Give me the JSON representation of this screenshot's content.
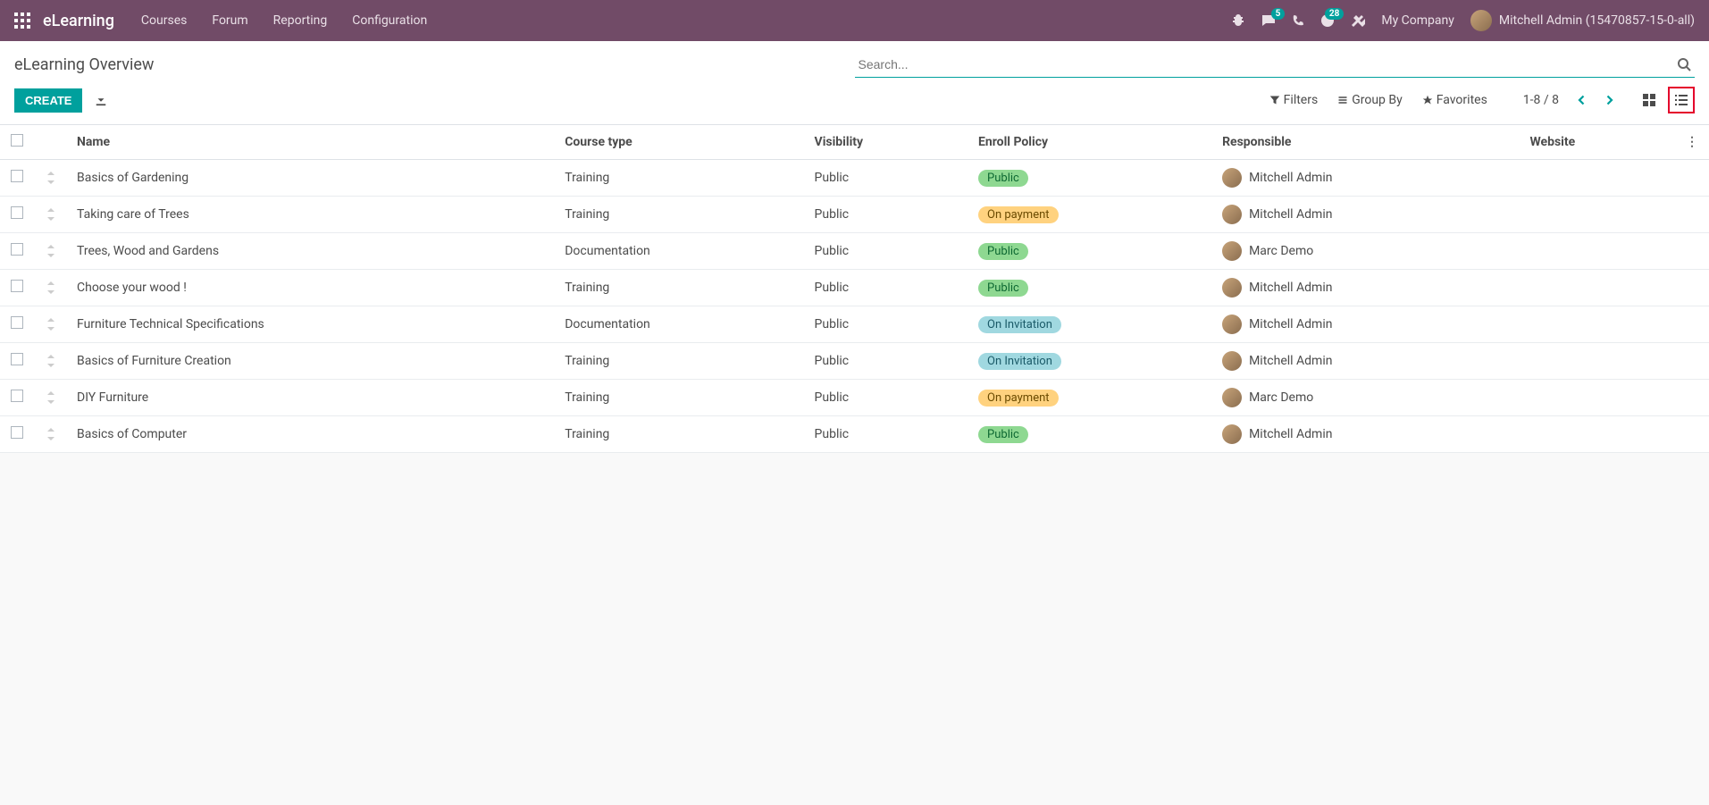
{
  "topbar": {
    "brand": "eLearning",
    "menu": [
      "Courses",
      "Forum",
      "Reporting",
      "Configuration"
    ],
    "messages_badge": "5",
    "activities_badge": "28",
    "company": "My Company",
    "user": "Mitchell Admin (15470857-15-0-all)"
  },
  "control_panel": {
    "breadcrumb": "eLearning Overview",
    "search_placeholder": "Search...",
    "create_btn": "CREATE",
    "filters": "Filters",
    "group_by": "Group By",
    "favorites": "Favorites",
    "pager": "1-8 / 8"
  },
  "table": {
    "headers": {
      "name": "Name",
      "course_type": "Course type",
      "visibility": "Visibility",
      "enroll_policy": "Enroll Policy",
      "responsible": "Responsible",
      "website": "Website"
    },
    "rows": [
      {
        "name": "Basics of Gardening",
        "course_type": "Training",
        "visibility": "Public",
        "enroll_policy": "Public",
        "enroll_class": "pill-public",
        "responsible": "Mitchell Admin",
        "website": ""
      },
      {
        "name": "Taking care of Trees",
        "course_type": "Training",
        "visibility": "Public",
        "enroll_policy": "On payment",
        "enroll_class": "pill-payment",
        "responsible": "Mitchell Admin",
        "website": ""
      },
      {
        "name": "Trees, Wood and Gardens",
        "course_type": "Documentation",
        "visibility": "Public",
        "enroll_policy": "Public",
        "enroll_class": "pill-public",
        "responsible": "Marc Demo",
        "website": ""
      },
      {
        "name": "Choose your wood !",
        "course_type": "Training",
        "visibility": "Public",
        "enroll_policy": "Public",
        "enroll_class": "pill-public",
        "responsible": "Mitchell Admin",
        "website": ""
      },
      {
        "name": "Furniture Technical Specifications",
        "course_type": "Documentation",
        "visibility": "Public",
        "enroll_policy": "On Invitation",
        "enroll_class": "pill-invitation",
        "responsible": "Mitchell Admin",
        "website": ""
      },
      {
        "name": "Basics of Furniture Creation",
        "course_type": "Training",
        "visibility": "Public",
        "enroll_policy": "On Invitation",
        "enroll_class": "pill-invitation",
        "responsible": "Mitchell Admin",
        "website": ""
      },
      {
        "name": "DIY Furniture",
        "course_type": "Training",
        "visibility": "Public",
        "enroll_policy": "On payment",
        "enroll_class": "pill-payment",
        "responsible": "Marc Demo",
        "website": ""
      },
      {
        "name": "Basics of Computer",
        "course_type": "Training",
        "visibility": "Public",
        "enroll_policy": "Public",
        "enroll_class": "pill-public",
        "responsible": "Mitchell Admin",
        "website": ""
      }
    ]
  }
}
